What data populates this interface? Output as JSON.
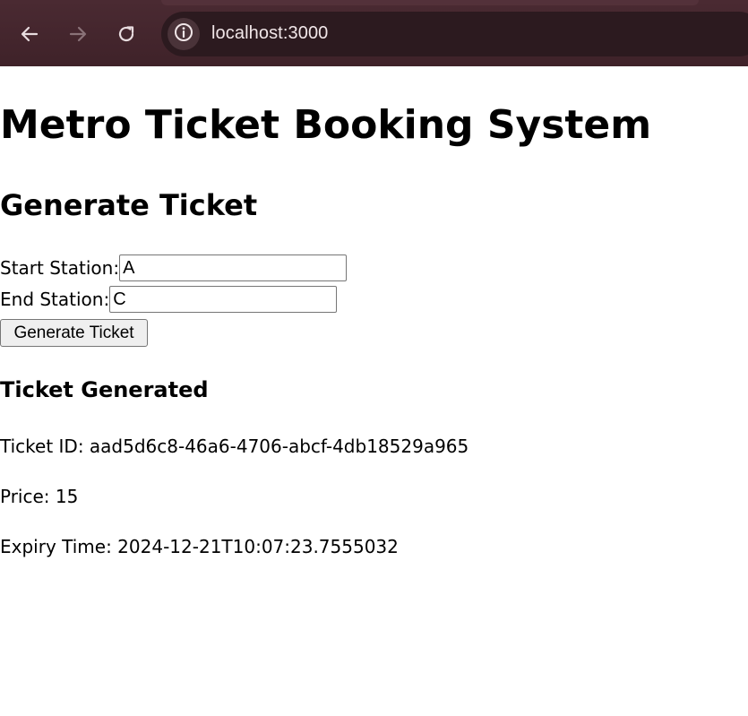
{
  "browser": {
    "url": "localhost:3000",
    "back_icon": "arrow-left-icon",
    "forward_icon": "arrow-right-icon",
    "reload_icon": "reload-icon",
    "site_info_icon": "info-icon",
    "chrome_color": "#3f2229"
  },
  "page": {
    "title": "Metro Ticket Booking System",
    "section_title": "Generate Ticket",
    "form": {
      "start_label": "Start Station:",
      "start_value": "A",
      "end_label": "End Station:",
      "end_value": "C",
      "submit_label": "Generate Ticket"
    },
    "result": {
      "title": "Ticket Generated",
      "ticket_id": "Ticket ID: aad5d6c8-46a6-4706-abcf-4db18529a965",
      "price": "Price: 15",
      "expiry": "Expiry Time: 2024-12-21T10:07:23.7555032"
    }
  }
}
